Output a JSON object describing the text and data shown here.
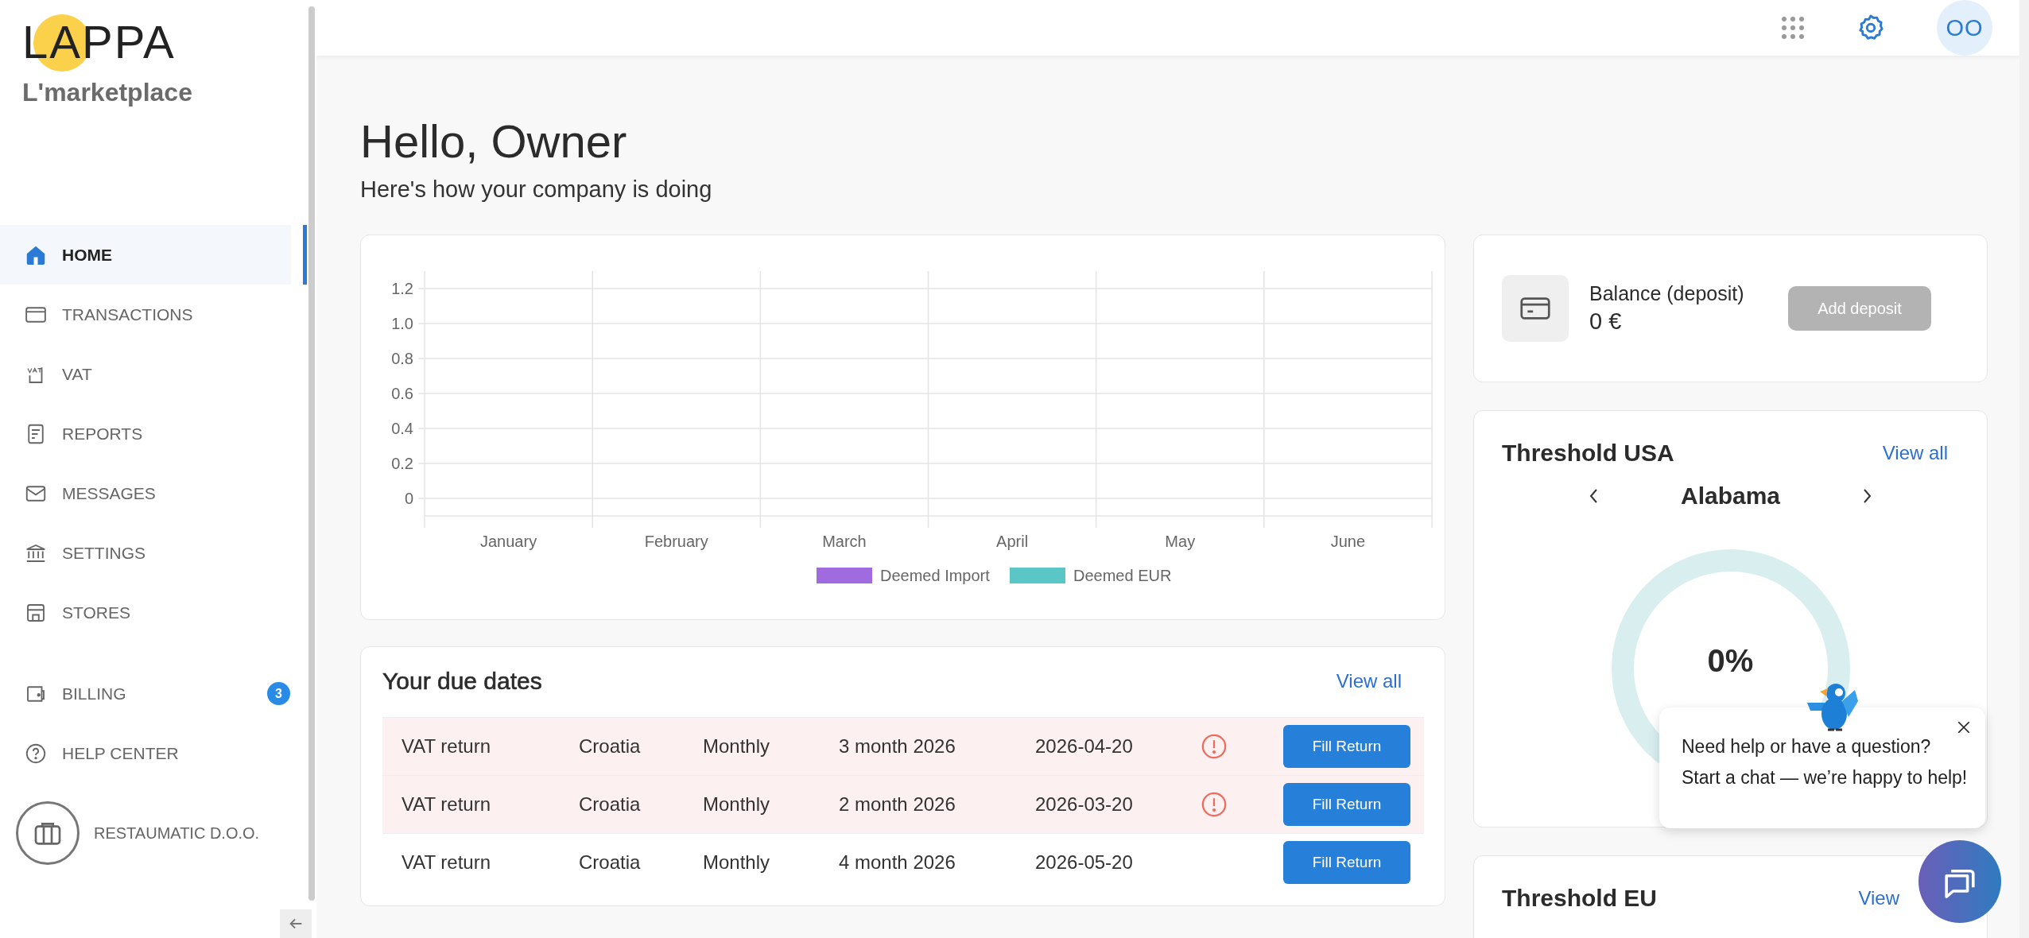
{
  "brand": {
    "logo": "LAPPA",
    "name": "L'marketplace"
  },
  "sidebar": {
    "sections": [
      [
        {
          "label": "HOME",
          "selected": true
        },
        {
          "label": "TRANSACTIONS",
          "selected": false
        },
        {
          "label": "VAT",
          "selected": false
        },
        {
          "label": "REPORTS",
          "selected": false
        },
        {
          "label": "MESSAGES",
          "selected": false
        },
        {
          "label": "SETTINGS",
          "selected": false
        },
        {
          "label": "STORES",
          "selected": false
        }
      ],
      [
        {
          "label": "BILLING",
          "selected": false,
          "badge": "3"
        },
        {
          "label": "HELP CENTER",
          "selected": false
        }
      ]
    ],
    "company": "RESTAUMATIC D.O.O."
  },
  "topbar": {
    "avatar": "OO"
  },
  "greeting": {
    "title": "Hello, Owner",
    "subtitle": "Here's how your company is doing"
  },
  "chart": {
    "chart_data": {
      "type": "bar",
      "categories": [
        "January",
        "February",
        "March",
        "April",
        "May",
        "June"
      ],
      "series": [
        {
          "name": "Deemed Import",
          "color": "#9f6bdf",
          "values": [
            0,
            0,
            0,
            0,
            0,
            0
          ]
        },
        {
          "name": "Deemed EUR",
          "color": "#5bc6c6",
          "values": [
            0,
            0,
            0,
            0,
            0,
            0
          ]
        }
      ],
      "grid": true,
      "ylim": [
        -0.1,
        1.3
      ],
      "yticks": [
        0,
        0.2,
        0.4,
        0.6,
        0.8,
        {
          "value": 1,
          "label": "1.0"
        },
        1.2
      ]
    }
  },
  "due_dates": {
    "title": "Your due dates",
    "view_all": "View all",
    "rows": [
      {
        "type": "VAT return",
        "country": "Croatia",
        "frequency": "Monthly",
        "period": "3 month 2026",
        "date": "2026-04-20",
        "overdue": true,
        "action": "Fill Return"
      },
      {
        "type": "VAT return",
        "country": "Croatia",
        "frequency": "Monthly",
        "period": "2 month 2026",
        "date": "2026-03-20",
        "overdue": true,
        "action": "Fill Return"
      },
      {
        "type": "VAT return",
        "country": "Croatia",
        "frequency": "Monthly",
        "period": "4 month 2026",
        "date": "2026-05-20",
        "overdue": false,
        "action": "Fill Return"
      }
    ]
  },
  "balance": {
    "label": "Balance (deposit)",
    "amount": "0 €",
    "button": {
      "label": "Add deposit",
      "disabled": true
    }
  },
  "threshold_usa": {
    "title": "Threshold USA",
    "view_all": "View all",
    "state": "Alabama",
    "value": "0%"
  },
  "threshold_eu": {
    "title": "Threshold EU",
    "view_all": "View"
  },
  "chat_popup": {
    "lines": [
      "Need help or have a question?",
      "Start a chat — we’re happy to help!"
    ]
  }
}
